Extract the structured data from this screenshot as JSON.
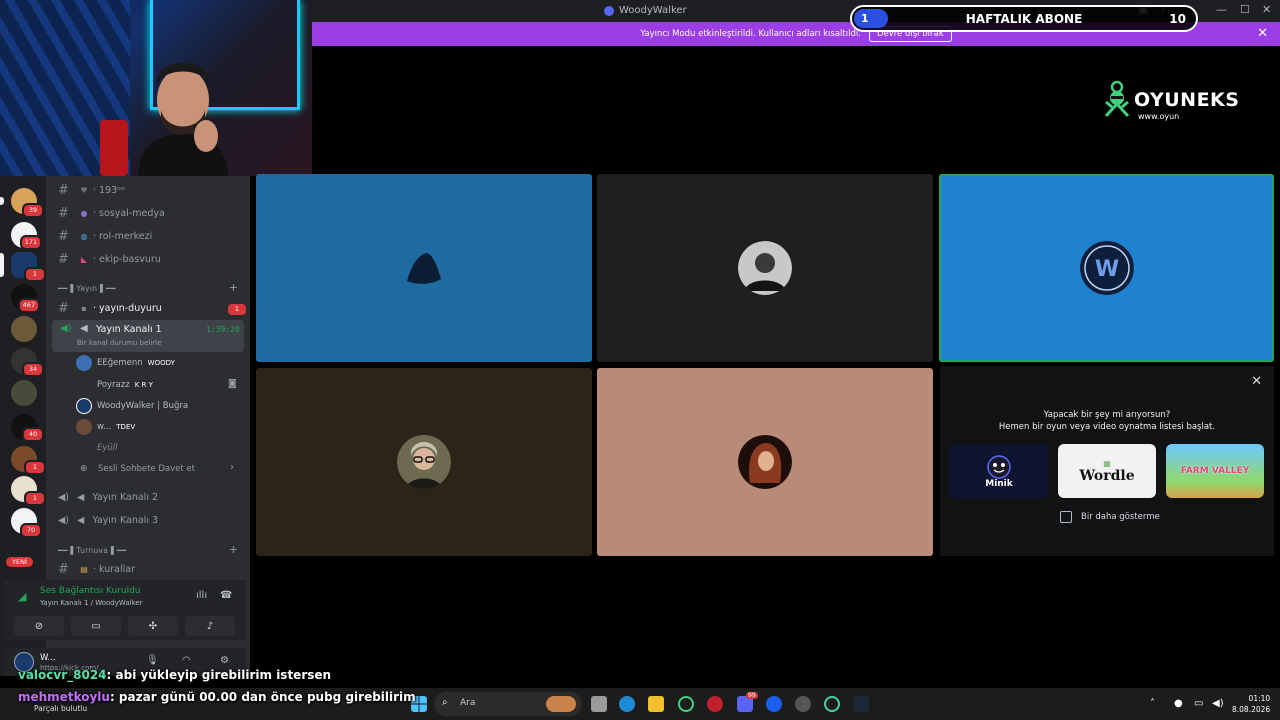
{
  "window": {
    "title": "WoodyWalker"
  },
  "banner": {
    "text": "Yayıncı Modu etkinleştirildi. Kullanıcı adları kısaltıldı.",
    "button_label": "Devre dışı bırak"
  },
  "subscriber_goal": {
    "label": "HAFTALIK ABONE",
    "current": "1",
    "target": "10",
    "progress": 0.1
  },
  "brand": {
    "name": "OYUNEKS",
    "url": "www.oyun"
  },
  "servers": [
    {
      "badge": "39"
    },
    {
      "badge": "171"
    },
    {
      "badge": "1"
    },
    {
      "badge": "467"
    },
    {
      "badge": ""
    },
    {
      "badge": "34"
    },
    {
      "badge": ""
    },
    {
      "badge": "40"
    },
    {
      "badge": "1"
    },
    {
      "badge": "1"
    },
    {
      "badge": "70"
    }
  ],
  "servers_new_label": "YENİ",
  "channels": {
    "text_channels_top": [
      {
        "name": "193ᵒᵒ",
        "emoji": "heart-icon"
      },
      {
        "name": "sosyal-medya",
        "emoji": "group-icon"
      },
      {
        "name": "rol-merkezi",
        "emoji": "globe-icon"
      },
      {
        "name": "ekip-basvuru",
        "emoji": "megaphone-icon"
      }
    ],
    "category_yayin": "━━ ▌Yayın ▌━━",
    "yayin_duyuru": {
      "name": "yayın-duyuru",
      "badge": "1"
    },
    "active_voice": {
      "name": "Yayın Kanalı 1",
      "time": "1:39:20",
      "status": "Bir kanal durumu belirle"
    },
    "members": [
      {
        "name": "EEĝemenn",
        "tag": "WOODY"
      },
      {
        "name": "Poyrazz",
        "tag": "K R Y"
      },
      {
        "name": "WoodyWalker | Buğra",
        "tag": ""
      },
      {
        "name": "w...",
        "tag": "TDEV"
      },
      {
        "name": "Eyüll",
        "tag": ""
      }
    ],
    "invite_label": "Sesli Sohbete Davet et",
    "other_voice": [
      "Yayın Kanalı 2",
      "Yayın Kanalı 3"
    ],
    "category_turnuva": "━━ ▌Turnuva ▌━━",
    "kurallar": "kurallar"
  },
  "voice_panel": {
    "status": "Ses Bağlantısı Kuruldu",
    "location": "Yayın Kanalı 1 / WoodyWalker"
  },
  "user_panel": {
    "name": "W...",
    "status": "https://kick.com/..."
  },
  "tiles": [
    {
      "color": "#1f6aa0"
    },
    {
      "color": "#1e1e1e"
    },
    {
      "color": "#1f82cf"
    },
    {
      "color": "#2b2519"
    },
    {
      "color": "#b88b79"
    }
  ],
  "activity": {
    "question": "Yapacak bir şey mi arıyorsun?",
    "subtitle": "Hemen bir oyun veya video oynatma listesi başlat.",
    "cards": [
      "Minik",
      "Wordle",
      "FARM VALLEY"
    ],
    "dont_show": "Bir daha gösterme"
  },
  "chat": [
    {
      "user": "valocvr_8024",
      "message": ": abi yükleyip girebilirim istersen"
    },
    {
      "user": "mehmetkoylu",
      "message": ": pazar günü 00.00 dan önce pubg girebilirim"
    }
  ],
  "taskbar": {
    "left_info": "Parçalı bulutlu",
    "search_placeholder": "Ara",
    "time": "01:10",
    "date": "8.08.2026",
    "discord_badge": "99"
  }
}
